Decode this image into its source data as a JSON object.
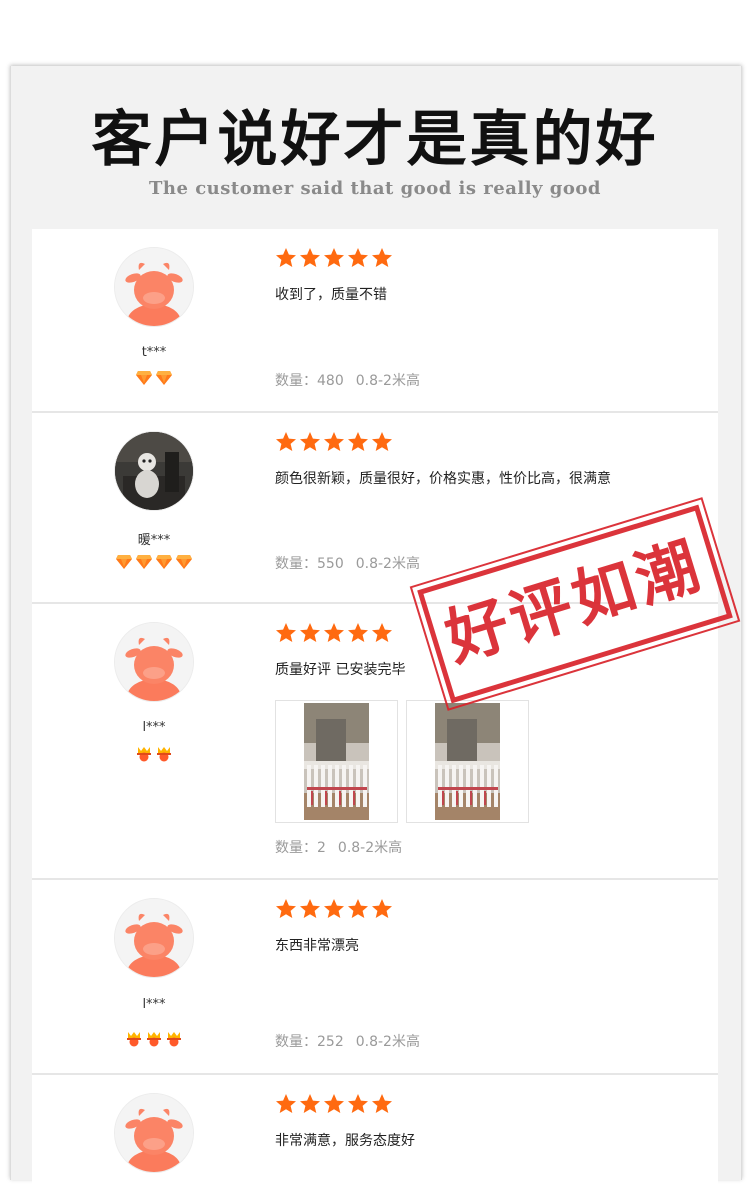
{
  "header": {
    "title": "客户说好才是真的好",
    "subtitle": "The customer said that good is really good"
  },
  "stamp_text": "好评如潮",
  "colors": {
    "star": "#ff6a10",
    "stamp": "#d9232b",
    "avatar": "#fb7b5c"
  },
  "reviews": [
    {
      "nickname": "t***",
      "rating": 5,
      "comment": "收到了，质量不错",
      "qty_label": "数量：480",
      "spec": "0.8-2米高",
      "avatar": "cow-avatar",
      "badge": "diamond-icon",
      "badge_count": 2,
      "photos": []
    },
    {
      "nickname": "暖***",
      "rating": 5,
      "comment": "颜色很新颖，质量很好，价格实惠，性价比高，很满意",
      "qty_label": "数量：550",
      "spec": "0.8-2米高",
      "avatar": "photo-avatar",
      "badge": "diamond-icon",
      "badge_count": 4,
      "photos": []
    },
    {
      "nickname": "l***",
      "rating": 5,
      "comment": "质量好评 已安装完毕",
      "qty_label": "数量：2",
      "spec": "0.8-2米高",
      "avatar": "cow-avatar",
      "badge": "crown-medal-icon",
      "badge_count": 2,
      "photos": [
        "fence-photo",
        "fence-photo"
      ]
    },
    {
      "nickname": "l***",
      "rating": 5,
      "comment": "东西非常漂亮",
      "qty_label": "数量：252",
      "spec": "0.8-2米高",
      "avatar": "cow-avatar",
      "badge": "crown-medal-icon",
      "badge_count": 3,
      "photos": []
    },
    {
      "nickname": "",
      "rating": 5,
      "comment": "非常满意，服务态度好",
      "qty_label": "",
      "spec": "",
      "avatar": "cow-avatar",
      "badge": "",
      "badge_count": 0,
      "photos": []
    }
  ]
}
